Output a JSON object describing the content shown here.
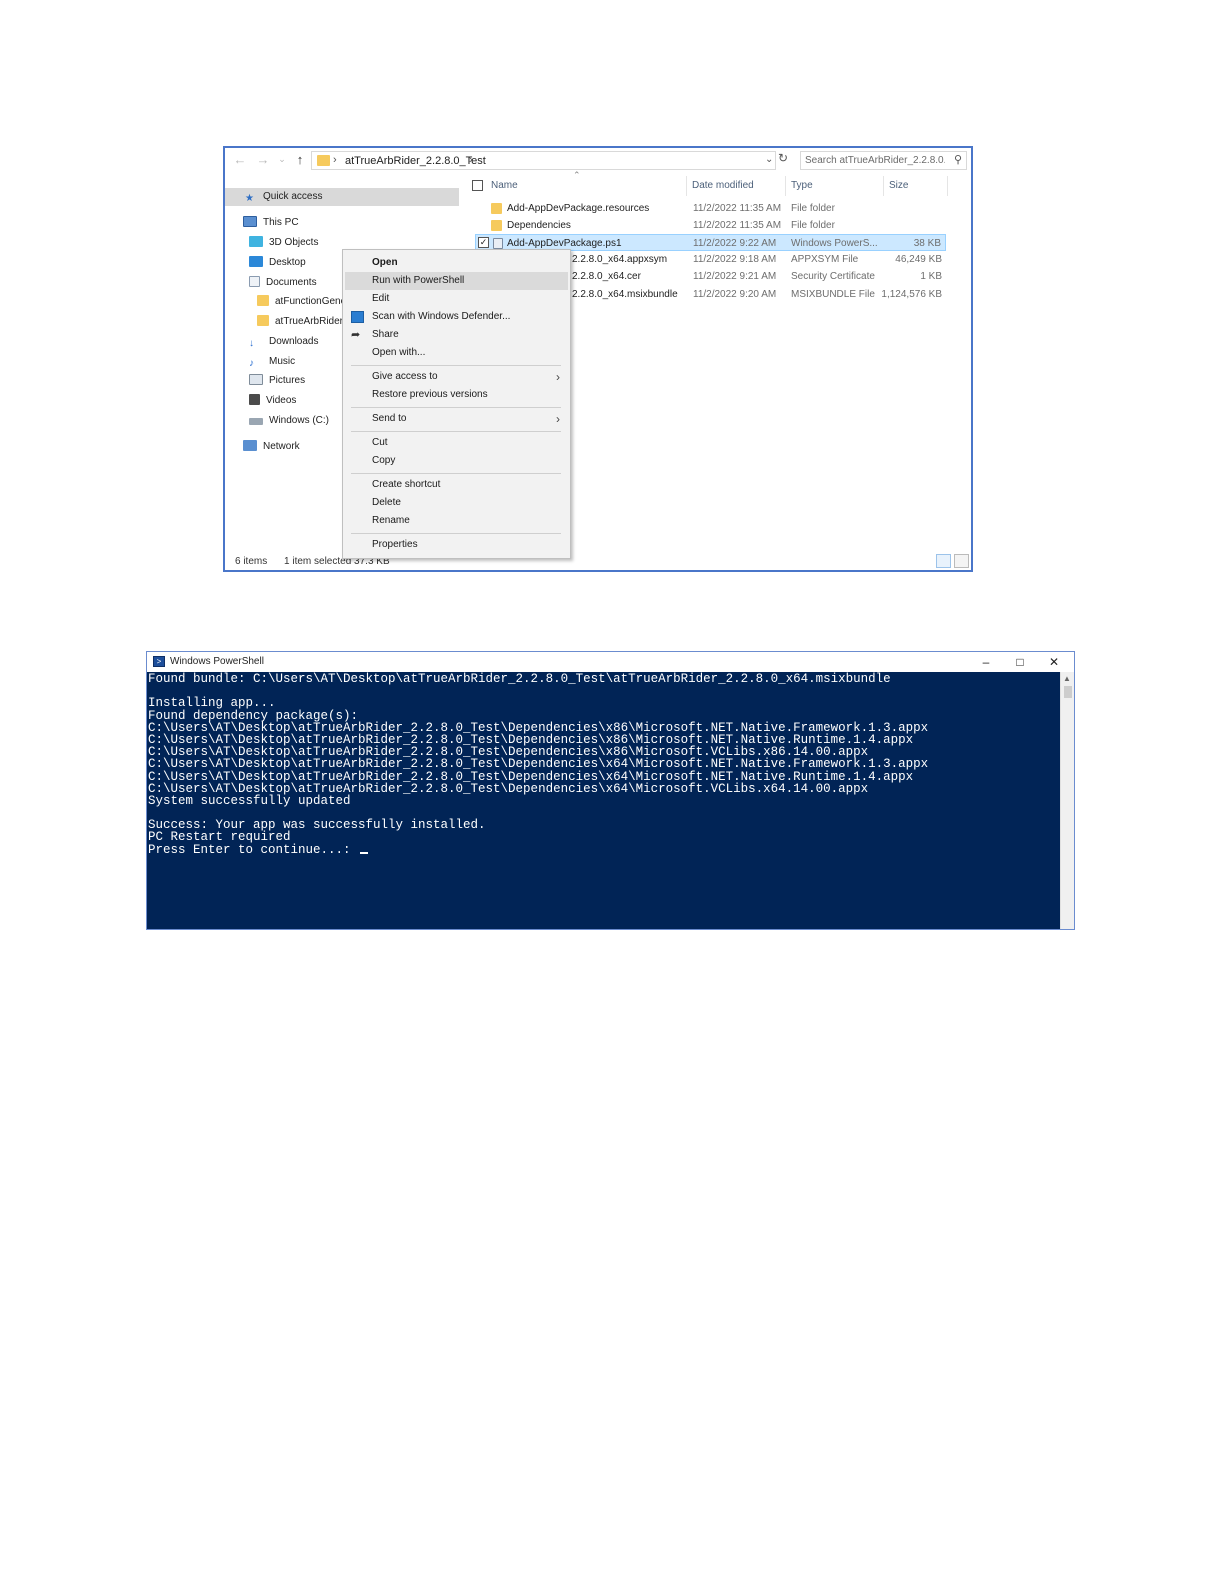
{
  "explorer": {
    "path": "atTrueArbRider_2.2.8.0_Test",
    "search_placeholder": "Search atTrueArbRider_2.2.8.0...",
    "nav": {
      "quick_access": "Quick access",
      "this_pc": "This PC",
      "items": [
        "3D Objects",
        "Desktop",
        "Documents",
        "atFunctionGene",
        "atTrueArbRider",
        "Downloads",
        "Music",
        "Pictures",
        "Videos",
        "Windows (C:)"
      ],
      "network": "Network"
    },
    "columns": {
      "name": "Name",
      "date": "Date modified",
      "type": "Type",
      "size": "Size"
    },
    "files": [
      {
        "name": "Add-AppDevPackage.resources",
        "date": "11/2/2022 11:35 AM",
        "type": "File folder",
        "size": ""
      },
      {
        "name": "Dependencies",
        "date": "11/2/2022 11:35 AM",
        "type": "File folder",
        "size": ""
      },
      {
        "name": "Add-AppDevPackage.ps1",
        "date": "11/2/2022 9:22 AM",
        "type": "Windows PowerS...",
        "size": "38 KB"
      },
      {
        "name": "2.2.8.0_x64.appxsym",
        "date": "11/2/2022 9:18 AM",
        "type": "APPXSYM File",
        "size": "46,249 KB"
      },
      {
        "name": "2.2.8.0_x64.cer",
        "date": "11/2/2022 9:21 AM",
        "type": "Security Certificate",
        "size": "1 KB"
      },
      {
        "name": "2.2.8.0_x64.msixbundle",
        "date": "11/2/2022 9:20 AM",
        "type": "MSIXBUNDLE File",
        "size": "1,124,576 KB"
      }
    ],
    "status": {
      "items": "6 items",
      "selected": "1 item selected  37.3 KB"
    }
  },
  "context_menu": {
    "open": "Open",
    "run_powershell": "Run with PowerShell",
    "edit": "Edit",
    "scan": "Scan with Windows Defender...",
    "share": "Share",
    "open_with": "Open with...",
    "give_access": "Give access to",
    "restore": "Restore previous versions",
    "send_to": "Send to",
    "cut": "Cut",
    "copy": "Copy",
    "create_shortcut": "Create shortcut",
    "delete": "Delete",
    "rename": "Rename",
    "properties": "Properties"
  },
  "powershell": {
    "title": "Windows PowerShell",
    "lines": [
      "Found bundle: C:\\Users\\AT\\Desktop\\atTrueArbRider_2.2.8.0_Test\\atTrueArbRider_2.2.8.0_x64.msixbundle",
      "",
      "Installing app...",
      "Found dependency package(s):",
      "C:\\Users\\AT\\Desktop\\atTrueArbRider_2.2.8.0_Test\\Dependencies\\x86\\Microsoft.NET.Native.Framework.1.3.appx",
      "C:\\Users\\AT\\Desktop\\atTrueArbRider_2.2.8.0_Test\\Dependencies\\x86\\Microsoft.NET.Native.Runtime.1.4.appx",
      "C:\\Users\\AT\\Desktop\\atTrueArbRider_2.2.8.0_Test\\Dependencies\\x86\\Microsoft.VCLibs.x86.14.00.appx",
      "C:\\Users\\AT\\Desktop\\atTrueArbRider_2.2.8.0_Test\\Dependencies\\x64\\Microsoft.NET.Native.Framework.1.3.appx",
      "C:\\Users\\AT\\Desktop\\atTrueArbRider_2.2.8.0_Test\\Dependencies\\x64\\Microsoft.NET.Native.Runtime.1.4.appx",
      "C:\\Users\\AT\\Desktop\\atTrueArbRider_2.2.8.0_Test\\Dependencies\\x64\\Microsoft.VCLibs.x64.14.00.appx",
      "System successfully updated",
      "",
      "Success: Your app was successfully installed.",
      "PC Restart required",
      "Press Enter to continue...: "
    ]
  },
  "colors": {
    "console_bg": "#012456",
    "window_border": "#4a76c9",
    "selection": "#cce8ff"
  }
}
